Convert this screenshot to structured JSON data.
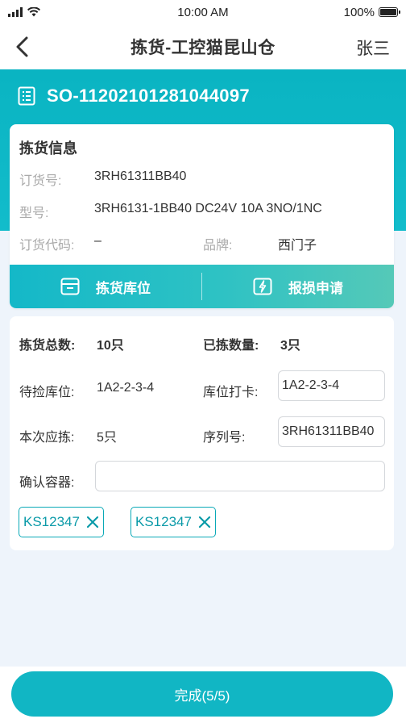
{
  "status_bar": {
    "time": "10:00 AM",
    "battery_text": "100%",
    "battery_level": 1.0,
    "icons": [
      "signal-icon",
      "wifi-icon",
      "battery-icon"
    ]
  },
  "nav": {
    "title": "拣货-工控猫昆山仓",
    "user": "张三",
    "back_icon": "chevron-left-icon"
  },
  "order": {
    "number": "SO-11202101281044097",
    "icon": "document-icon"
  },
  "info": {
    "title": "拣货信息",
    "order_code_label": "订货号:",
    "order_code": "3RH61311BB40",
    "model_label": "型号:",
    "model": "3RH6131-1BB40 DC24V 10A 3NO/1NC",
    "order_alias_label": "订货代码:",
    "order_alias": "–",
    "brand_label": "品牌:",
    "brand": "西门子"
  },
  "actions": {
    "pick_location": "拣货库位",
    "pick_location_icon": "box-icon",
    "damage_report": "报损申请",
    "damage_report_icon": "lightning-icon"
  },
  "picking": {
    "total_label": "拣货总数:",
    "total": "10只",
    "picked_label": "已拣数量:",
    "picked": "3只",
    "pending_location_label": "待捡库位:",
    "pending_location": "1A2-2-3-4",
    "scan_location_label": "库位打卡:",
    "scan_location_value": "1A2-2-3-4",
    "this_pick_label": "本次应拣:",
    "this_pick": "5只",
    "serial_label": "序列号:",
    "serial_value": "3RH61311BB40",
    "container_label": "确认容器:",
    "container_value": "",
    "tags": [
      {
        "label": "KS12347"
      },
      {
        "label": "KS12347"
      }
    ]
  },
  "footer": {
    "done_label": "完成(5/5)"
  },
  "colors": {
    "accent": "#11b6c4",
    "tag_border": "#0aa9b7",
    "background": "#eef4fb"
  }
}
